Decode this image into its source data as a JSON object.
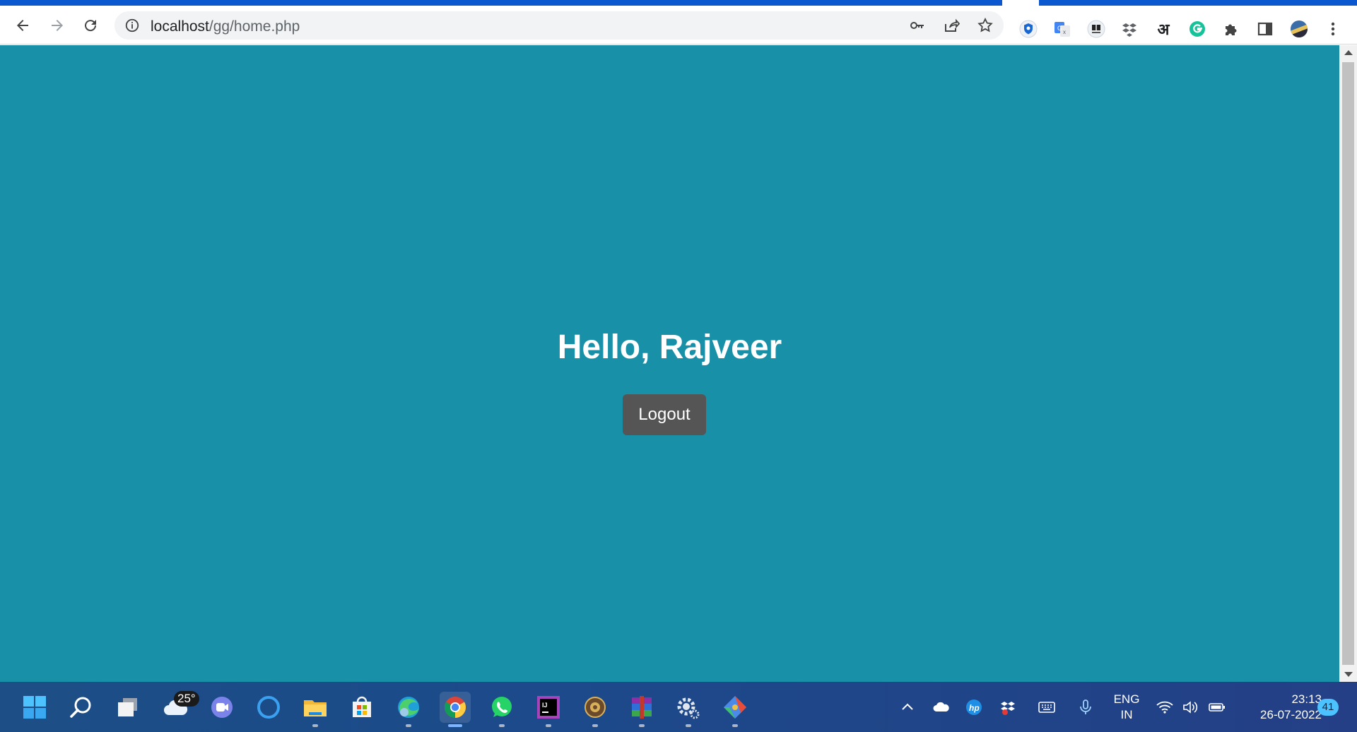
{
  "browser": {
    "url_host": "localhost",
    "url_path": "/gg/home.php",
    "nav_icons": [
      "back-icon",
      "forward-icon",
      "reload-icon"
    ],
    "omnibox_icons": [
      "site-info-icon",
      "password-key-icon",
      "share-icon",
      "bookmark-star-icon"
    ],
    "extensions": [
      "shield-extension-icon",
      "google-translate-icon",
      "dolby-voice-icon",
      "dropbox-icon",
      "hindi-input-icon",
      "grammarly-icon",
      "extensions-puzzle-icon",
      "side-panel-icon",
      "profile-avatar-icon",
      "menu-kebab-icon"
    ],
    "hindi_glyph": "अ"
  },
  "page": {
    "greeting": "Hello, Rajveer",
    "logout_label": "Logout",
    "background_color": "#1790a8",
    "button_color": "#555555"
  },
  "taskbar": {
    "apps": [
      "start-icon",
      "search-icon",
      "task-view-icon",
      "weather-icon",
      "teams-chat-icon",
      "cortana-icon",
      "file-explorer-icon",
      "microsoft-store-icon",
      "edge-icon",
      "chrome-icon",
      "whatsapp-icon",
      "intellij-icon",
      "app-gear-icon",
      "winrar-icon",
      "settings-icon",
      "git-icon"
    ],
    "weather_temp": "25°",
    "tray_icons": [
      "show-hidden-icon",
      "onedrive-icon",
      "hp-icon",
      "dropbox-tray-icon",
      "touch-keyboard-icon",
      "microphone-icon",
      "wifi-icon",
      "volume-icon",
      "battery-icon"
    ],
    "language_line1": "ENG",
    "language_line2": "IN",
    "time": "23:13",
    "date": "26-07-2022",
    "notification_count": "41"
  }
}
